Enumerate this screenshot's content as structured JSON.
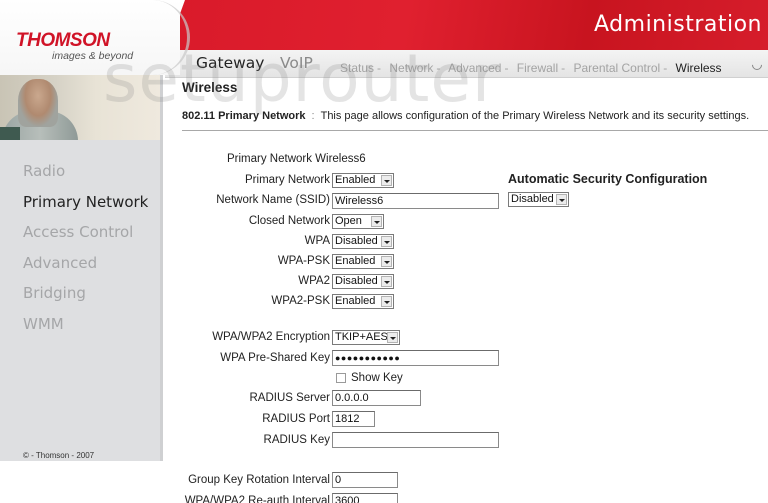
{
  "brand": {
    "name": "THOMSON",
    "tagline": "images & beyond",
    "accent_color": "#d91a2a"
  },
  "header": {
    "title": "Administration"
  },
  "nav": {
    "main": [
      {
        "label": "Gateway",
        "active": true
      },
      {
        "label": "VoIP",
        "active": false
      }
    ],
    "sub": [
      {
        "label": "Status",
        "active": false
      },
      {
        "label": "Network",
        "active": false
      },
      {
        "label": "Advanced",
        "active": false
      },
      {
        "label": "Firewall",
        "active": false
      },
      {
        "label": "Parental Control",
        "active": false
      },
      {
        "label": "Wireless",
        "active": true
      }
    ],
    "separator": "-",
    "status_icon": "loading-spinner-icon"
  },
  "sidebar": {
    "items": [
      {
        "label": "Radio",
        "active": false
      },
      {
        "label": "Primary Network",
        "active": true
      },
      {
        "label": "Access Control",
        "active": false
      },
      {
        "label": "Advanced",
        "active": false
      },
      {
        "label": "Bridging",
        "active": false
      },
      {
        "label": "WMM",
        "active": false
      }
    ],
    "copyright": "© - Thomson - 2007"
  },
  "watermark": "setuprouter",
  "page": {
    "heading": "Wireless",
    "desc_label": "802.11 Primary Network",
    "desc_sep": ":",
    "desc_text": "This page allows configuration of the Primary Wireless Network and its security settings."
  },
  "form": {
    "network_caption": "Primary Network Wireless6",
    "primary_network": {
      "label": "Primary Network",
      "value": "Enabled"
    },
    "ssid": {
      "label": "Network Name (SSID)",
      "value": "Wireless6"
    },
    "closed_network": {
      "label": "Closed Network",
      "value": "Open"
    },
    "wpa": {
      "label": "WPA",
      "value": "Disabled"
    },
    "wpa_psk": {
      "label": "WPA-PSK",
      "value": "Enabled"
    },
    "wpa2": {
      "label": "WPA2",
      "value": "Disabled"
    },
    "wpa2_psk": {
      "label": "WPA2-PSK",
      "value": "Enabled"
    },
    "encryption": {
      "label": "WPA/WPA2 Encryption",
      "value": "TKIP+AES"
    },
    "psk": {
      "label": "WPA Pre-Shared Key",
      "value": "●●●●●●●●●●●"
    },
    "show_key": {
      "label": "Show Key",
      "checked": false
    },
    "radius_server": {
      "label": "RADIUS Server",
      "value": "0.0.0.0"
    },
    "radius_port": {
      "label": "RADIUS Port",
      "value": "1812"
    },
    "radius_key": {
      "label": "RADIUS Key",
      "value": ""
    },
    "group_key_interval": {
      "label": "Group Key Rotation Interval",
      "value": "0"
    },
    "reauth_interval": {
      "label": "WPA/WPA2 Re-auth Interval",
      "value": "3600"
    }
  },
  "auto_security": {
    "title": "Automatic Security Configuration",
    "value": "Disabled"
  }
}
